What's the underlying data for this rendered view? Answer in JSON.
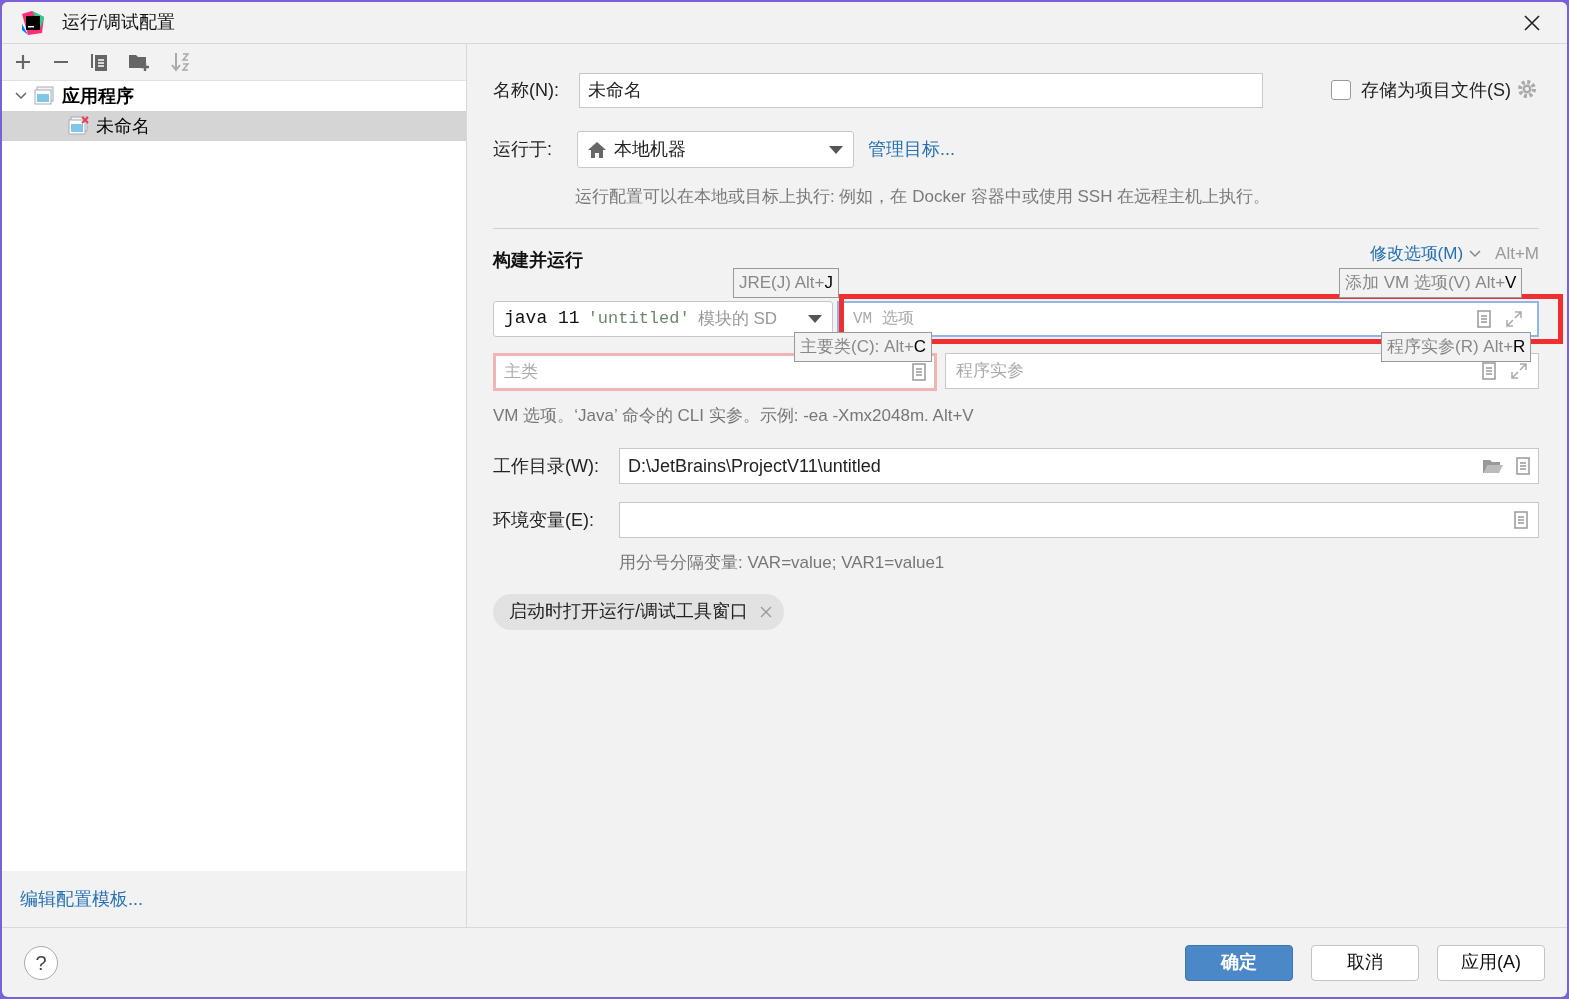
{
  "window": {
    "title": "运行/调试配置"
  },
  "tree": [
    {
      "label": "应用程序",
      "expanded": true,
      "selected": false,
      "children": [
        {
          "label": "未命名",
          "selected": true,
          "error": true
        }
      ]
    }
  ],
  "edit_templates_link": "编辑配置模板...",
  "name": {
    "label": "名称(N):",
    "value": "未命名"
  },
  "store_as_project_file": {
    "label": "存储为项目文件(S)",
    "checked": false
  },
  "run_on": {
    "label": "运行于:",
    "value": "本地机器",
    "manage_link": "管理目标...",
    "description": "运行配置可以在本地或目标上执行: 例如，在 Docker 容器中或使用 SSH 在远程主机上执行。"
  },
  "build_run": {
    "title": "构建并运行",
    "modify_options": "修改选项(M)",
    "modify_shortcut": "Alt+M",
    "jre": {
      "keyword": "java 11",
      "module": "'untitled'",
      "suffix": "模块的 SD"
    },
    "vm_placeholder": "VM 选项",
    "main_class_placeholder": "主类",
    "program_args_placeholder": "程序实参",
    "hint": "VM 选项。‘Java’ 命令的 CLI 实参。示例: -ea -Xmx2048m. Alt+V"
  },
  "shortcut_popups": [
    {
      "label": "JRE(J) Alt+",
      "key": "J"
    },
    {
      "label": "添加 VM 选项(V) Alt+",
      "key": "V"
    },
    {
      "label": "主要类(C): Alt+",
      "key": "C"
    },
    {
      "label": "程序实参(R) Alt+",
      "key": "R"
    }
  ],
  "working_dir": {
    "label": "工作目录(W):",
    "value": "D:\\JetBrains\\ProjectV11\\untitled"
  },
  "env_vars": {
    "label": "环境变量(E):",
    "hint": "用分号分隔变量: VAR=value; VAR1=value1"
  },
  "chip": {
    "label": "启动时打开运行/调试工具窗口"
  },
  "help": "?",
  "buttons": [
    {
      "label": "确定",
      "default": true
    },
    {
      "label": "取消",
      "default": false
    },
    {
      "label": "应用(A)",
      "default": false
    }
  ]
}
